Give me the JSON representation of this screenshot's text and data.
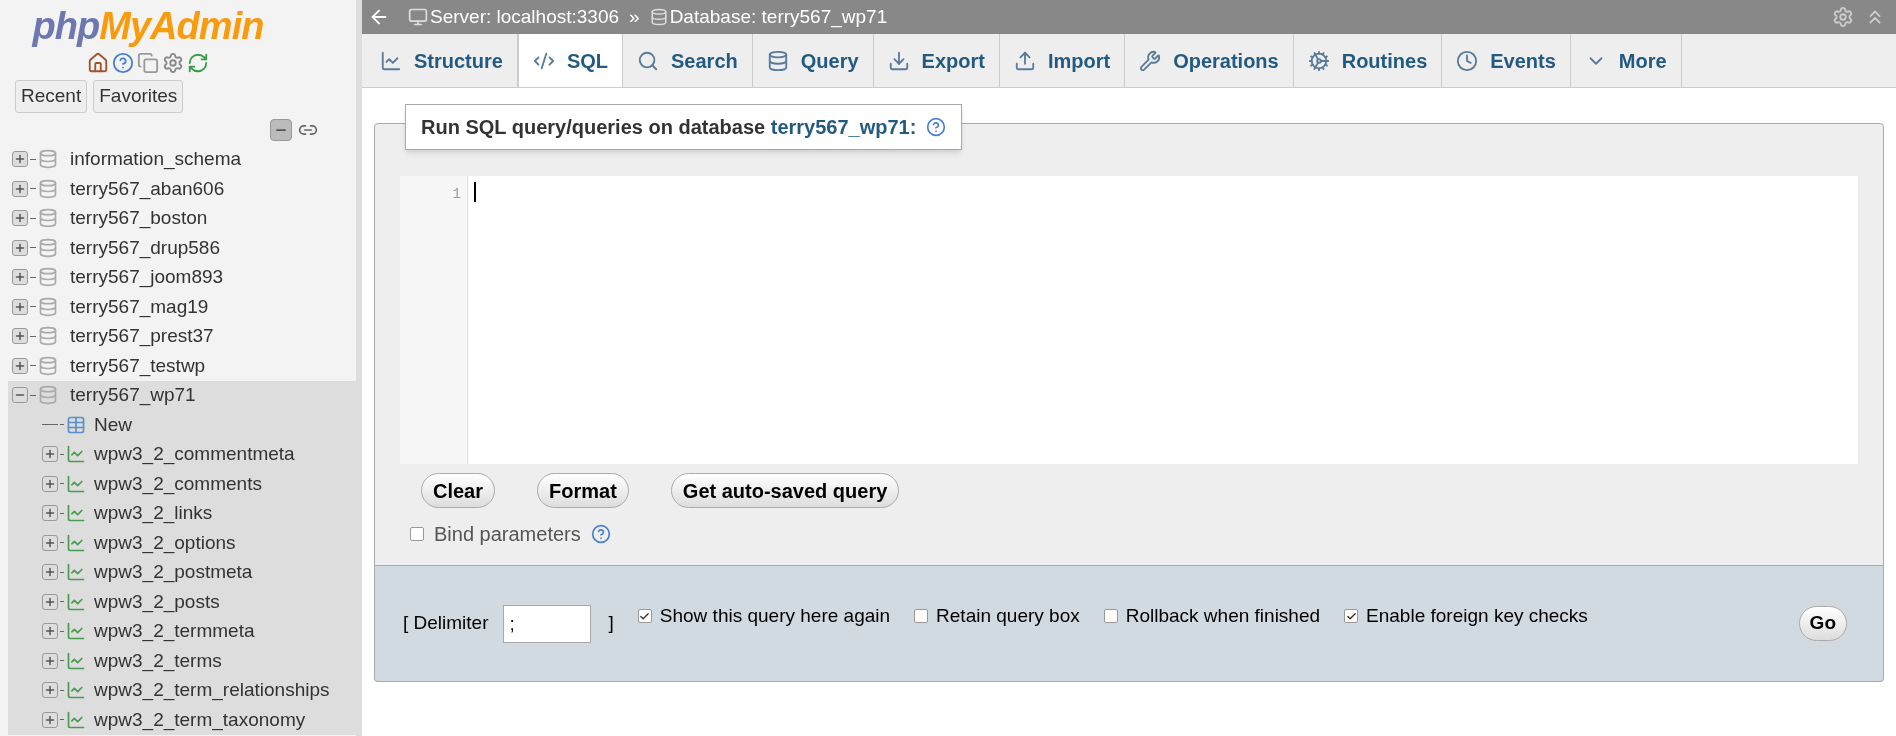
{
  "logo": {
    "part1": "php",
    "part2": "MyAdmin"
  },
  "nav_buttons": [
    "Recent",
    "Favorites"
  ],
  "tree": [
    {
      "name": "information_schema",
      "expanded": false
    },
    {
      "name": "terry567_aban606",
      "expanded": false
    },
    {
      "name": "terry567_boston",
      "expanded": false
    },
    {
      "name": "terry567_drup586",
      "expanded": false
    },
    {
      "name": "terry567_joom893",
      "expanded": false
    },
    {
      "name": "terry567_mag19",
      "expanded": false
    },
    {
      "name": "terry567_prest37",
      "expanded": false
    },
    {
      "name": "terry567_testwp",
      "expanded": false
    },
    {
      "name": "terry567_wp71",
      "expanded": true,
      "children": [
        {
          "name": "New",
          "kind": "new"
        },
        {
          "name": "wpw3_2_commentmeta",
          "kind": "table"
        },
        {
          "name": "wpw3_2_comments",
          "kind": "table"
        },
        {
          "name": "wpw3_2_links",
          "kind": "table"
        },
        {
          "name": "wpw3_2_options",
          "kind": "table"
        },
        {
          "name": "wpw3_2_postmeta",
          "kind": "table"
        },
        {
          "name": "wpw3_2_posts",
          "kind": "table"
        },
        {
          "name": "wpw3_2_termmeta",
          "kind": "table"
        },
        {
          "name": "wpw3_2_terms",
          "kind": "table"
        },
        {
          "name": "wpw3_2_term_relationships",
          "kind": "table"
        },
        {
          "name": "wpw3_2_term_taxonomy",
          "kind": "table"
        }
      ]
    }
  ],
  "breadcrumb": {
    "server": "Server: localhost:3306",
    "separator": "»",
    "database": "Database: terry567_wp71"
  },
  "tabs": [
    {
      "label": "Structure",
      "selected": false
    },
    {
      "label": "SQL",
      "selected": true
    },
    {
      "label": "Search",
      "selected": false
    },
    {
      "label": "Query",
      "selected": false
    },
    {
      "label": "Export",
      "selected": false
    },
    {
      "label": "Import",
      "selected": false
    },
    {
      "label": "Operations",
      "selected": false
    },
    {
      "label": "Routines",
      "selected": false
    },
    {
      "label": "Events",
      "selected": false
    },
    {
      "label": "More",
      "selected": false
    }
  ],
  "sql_box": {
    "legend": "Run SQL query/queries on database",
    "database": "terry567_wp71:",
    "line_number": "1",
    "buttons": [
      "Clear",
      "Format",
      "Get auto-saved query"
    ],
    "bind_parameters": {
      "label": "Bind parameters",
      "checked": false
    }
  },
  "options": {
    "delimiter_label": "[ Delimiter",
    "delimiter_value": ";",
    "delimiter_close": "]",
    "checkboxes": [
      {
        "label": "Show this query here again",
        "checked": true
      },
      {
        "label": "Retain query box",
        "checked": false
      },
      {
        "label": "Rollback when finished",
        "checked": false
      },
      {
        "label": "Enable foreign key checks",
        "checked": true
      }
    ],
    "go": "Go"
  }
}
